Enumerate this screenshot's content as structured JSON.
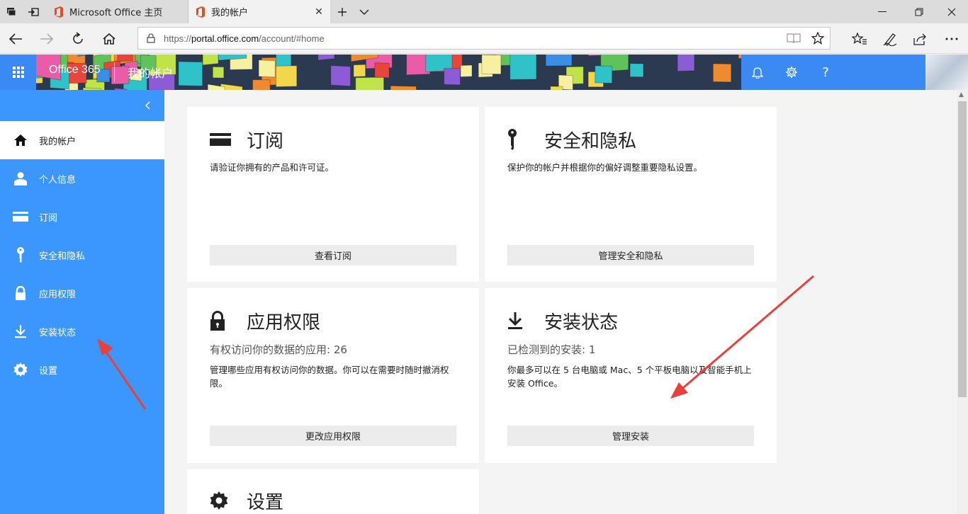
{
  "browser": {
    "tabs": [
      {
        "title": "Microsoft Office 主页",
        "active": false
      },
      {
        "title": "我的帐户",
        "active": true
      }
    ],
    "url": {
      "scheme": "https://",
      "host": "portal.office.com",
      "path": "/account/#home"
    },
    "icons": [
      "back-icon",
      "forward-icon",
      "refresh-icon",
      "home-icon",
      "lock-icon",
      "reading-view-icon",
      "favorite-star-icon",
      "favorites-hub-icon",
      "notes-pen-icon",
      "share-icon",
      "more-icon",
      "new-tab-icon",
      "tab-list-icon",
      "minimize-icon",
      "restore-icon",
      "close-icon"
    ]
  },
  "header": {
    "brand": "Office 365",
    "page_title": "我的帐户",
    "bg_color": "#3b8af4"
  },
  "sidebar": {
    "bg_color": "#3b96fd",
    "items": [
      {
        "label": "我的帐户",
        "icon": "home-icon",
        "selected": true
      },
      {
        "label": "个人信息",
        "icon": "person-icon"
      },
      {
        "label": "订阅",
        "icon": "card-icon"
      },
      {
        "label": "安全和隐私",
        "icon": "key-icon"
      },
      {
        "label": "应用权限",
        "icon": "lock-icon"
      },
      {
        "label": "安装状态",
        "icon": "download-icon"
      },
      {
        "label": "设置",
        "icon": "gear-icon"
      }
    ]
  },
  "cards": {
    "subscription": {
      "title": "订阅",
      "desc": "请验证你拥有的产品和许可证。",
      "button": "查看订阅"
    },
    "security": {
      "title": "安全和隐私",
      "desc": "保护你的帐户并根据你的偏好调整重要隐私设置。",
      "button": "管理安全和隐私"
    },
    "apppermissions": {
      "title": "应用权限",
      "stat": "有权访问你的数据的应用: 26",
      "desc": "管理哪些应用有权访问你的数据。你可以在需要时随时撤消权限。",
      "button": "更改应用权限"
    },
    "install": {
      "title": "安装状态",
      "stat": "已检测到的安装: 1",
      "desc": "你最多可以在 5 台电脑或 Mac、5 个平板电脑以及智能手机上安装 Office。",
      "button": "管理安装"
    },
    "settings": {
      "title": "设置"
    }
  },
  "annotations": {
    "arrow_color": "#e8403a"
  }
}
